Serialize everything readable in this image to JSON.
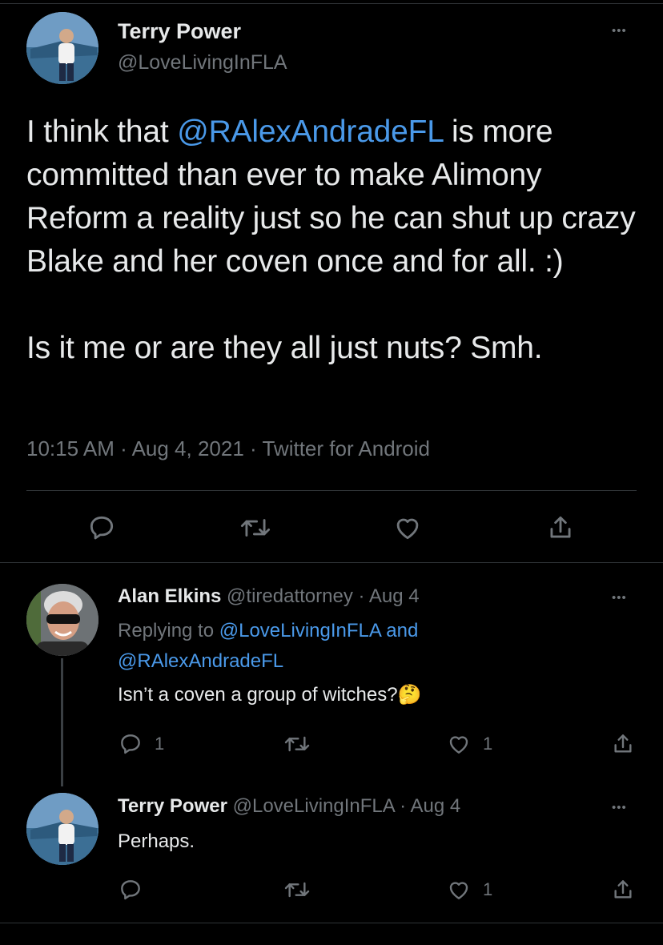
{
  "main_tweet": {
    "author_name": "Terry Power",
    "author_handle": "@LoveLivingInFLA",
    "text_before_mention": "I think that ",
    "mention": "@RAlexAndradeFL",
    "text_after_mention": " is more committed than ever to make Alimony Reform a reality just so he can shut up crazy Blake and her coven once and for all.  :)",
    "text_line2": "Is it me or are they all just nuts? Smh.",
    "time": "10:15 AM",
    "date": "Aug 4, 2021",
    "source": "Twitter for Android",
    "separator": "·",
    "more_label": "•••"
  },
  "replies": [
    {
      "author_name": "Alan Elkins",
      "author_handle": "@tiredattorney",
      "date": "Aug 4",
      "replying_prefix": "Replying to ",
      "replying_to_1": "@LoveLivingInFLA",
      "replying_and": " and",
      "replying_to_2": "@RAlexAndradeFL",
      "text": "Isn’t a coven a group of witches?",
      "emoji": "🤔",
      "reply_count": "1",
      "retweet_count": "",
      "like_count": "1",
      "more_label": "•••"
    },
    {
      "author_name": "Terry Power",
      "author_handle": "@LoveLivingInFLA",
      "date": "Aug 4",
      "text": "Perhaps.",
      "reply_count": "",
      "retweet_count": "",
      "like_count": "1",
      "more_label": "•••"
    }
  ],
  "colors": {
    "background": "#000000",
    "text": "#e7e9ea",
    "muted": "#71767b",
    "link": "#4a99e9",
    "divider": "#2f3336"
  }
}
